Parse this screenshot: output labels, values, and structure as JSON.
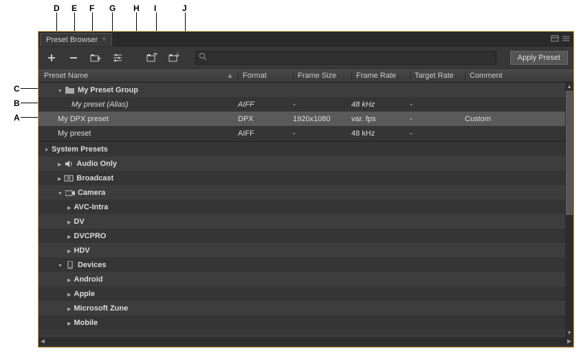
{
  "callouts": {
    "A": "A",
    "B": "B",
    "C": "C",
    "D": "D",
    "E": "E",
    "F": "F",
    "G": "G",
    "H": "H",
    "I": "I",
    "J": "J"
  },
  "panel": {
    "tab_title": "Preset Browser",
    "search_placeholder": "",
    "apply_label": "Apply Preset"
  },
  "toolbar_icons": {
    "create": "create-preset",
    "delete": "delete-preset",
    "group": "new-group",
    "settings": "preset-settings",
    "import": "import-preset",
    "export": "export-preset"
  },
  "columns": {
    "name": "Preset Name",
    "format": "Format",
    "frame_size": "Frame Size",
    "frame_rate": "Frame Rate",
    "target_rate": "Target Rate",
    "comment": "Comment"
  },
  "rows": [
    {
      "name": "My Preset Group",
      "type": "group",
      "expanded": true,
      "indent": 1
    },
    {
      "name": "My preset (Alias)",
      "type": "alias-italic",
      "format": "AIFF",
      "frame_size": "-",
      "frame_rate": "48 kHz",
      "target_rate": "-",
      "comment": "",
      "indent": 2
    },
    {
      "name": "My DPX preset",
      "type": "preset",
      "selected": true,
      "format": "DPX",
      "frame_size": "1920x1080",
      "frame_rate": "var. fps",
      "target_rate": "-",
      "comment": "Custom",
      "indent": 1
    },
    {
      "name": "My preset",
      "type": "preset",
      "format": "AIFF",
      "frame_size": "-",
      "frame_rate": "48 kHz",
      "target_rate": "-",
      "comment": "",
      "indent": 1
    },
    {
      "type": "divider"
    },
    {
      "name": "System Presets",
      "type": "category",
      "expanded": true,
      "indent": 0
    },
    {
      "name": "Audio Only",
      "type": "folder-audio",
      "expanded": false,
      "indent": 1
    },
    {
      "name": "Broadcast",
      "type": "folder-broadcast",
      "expanded": false,
      "indent": 1
    },
    {
      "name": "Camera",
      "type": "folder-camera",
      "expanded": true,
      "indent": 1
    },
    {
      "name": "AVC-Intra",
      "type": "sub",
      "expanded": false,
      "indent": 3
    },
    {
      "name": "DV",
      "type": "sub",
      "expanded": false,
      "indent": 3
    },
    {
      "name": "DVCPRO",
      "type": "sub",
      "expanded": false,
      "indent": 3
    },
    {
      "name": "HDV",
      "type": "sub",
      "expanded": false,
      "indent": 3
    },
    {
      "name": "Devices",
      "type": "folder-devices",
      "expanded": true,
      "indent": 1
    },
    {
      "name": "Android",
      "type": "sub",
      "expanded": false,
      "indent": 3
    },
    {
      "name": "Apple",
      "type": "sub",
      "expanded": false,
      "indent": 3
    },
    {
      "name": "Microsoft Zune",
      "type": "sub",
      "expanded": false,
      "indent": 3
    },
    {
      "name": "Mobile",
      "type": "sub",
      "expanded": false,
      "indent": 3
    }
  ]
}
